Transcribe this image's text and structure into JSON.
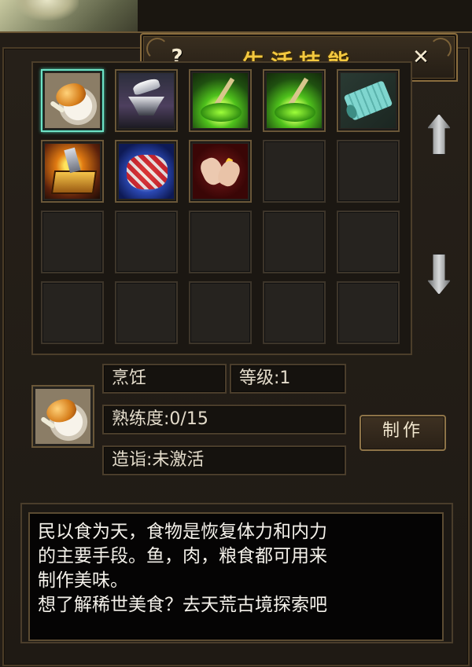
{
  "window": {
    "title": "生活技能",
    "help_label": "?",
    "close_label": "✕"
  },
  "skills": [
    {
      "name": "cooking",
      "icon": "roast-chicken-icon",
      "filled": true,
      "selected": true
    },
    {
      "name": "smithing",
      "icon": "anvil-hammer-icon",
      "filled": true,
      "selected": false
    },
    {
      "name": "alchemy",
      "icon": "herb-cauldron-icon",
      "filled": true,
      "selected": false
    },
    {
      "name": "alchemy-2",
      "icon": "herb-cauldron-icon",
      "filled": true,
      "selected": false
    },
    {
      "name": "scroll",
      "icon": "scroll-icon",
      "filled": true,
      "selected": false
    },
    {
      "name": "gold-forging",
      "icon": "gold-box-icon",
      "filled": true,
      "selected": false
    },
    {
      "name": "tailoring",
      "icon": "cloth-icon",
      "filled": true,
      "selected": false
    },
    {
      "name": "sewing",
      "icon": "sewing-hands-icon",
      "filled": true,
      "selected": false
    }
  ],
  "grid": {
    "rows": 4,
    "cols": 5
  },
  "selected": {
    "icon": "roast-chicken-icon",
    "name": "烹饪",
    "level": "等级:1",
    "proficiency": "熟练度:0/15",
    "attainment": "造诣:未激活"
  },
  "buttons": {
    "make_label": "制作"
  },
  "description": {
    "text": "民以食为天，食物是恢复体力和内力\n的主要手段。鱼，肉，粮食都可用来\n制作美味。\n想了解稀世美食？去天荒古境探索吧"
  },
  "colors": {
    "title": "#f3c83f",
    "selected_border": "#6fe2c5",
    "frame": "#8a6d3e"
  }
}
